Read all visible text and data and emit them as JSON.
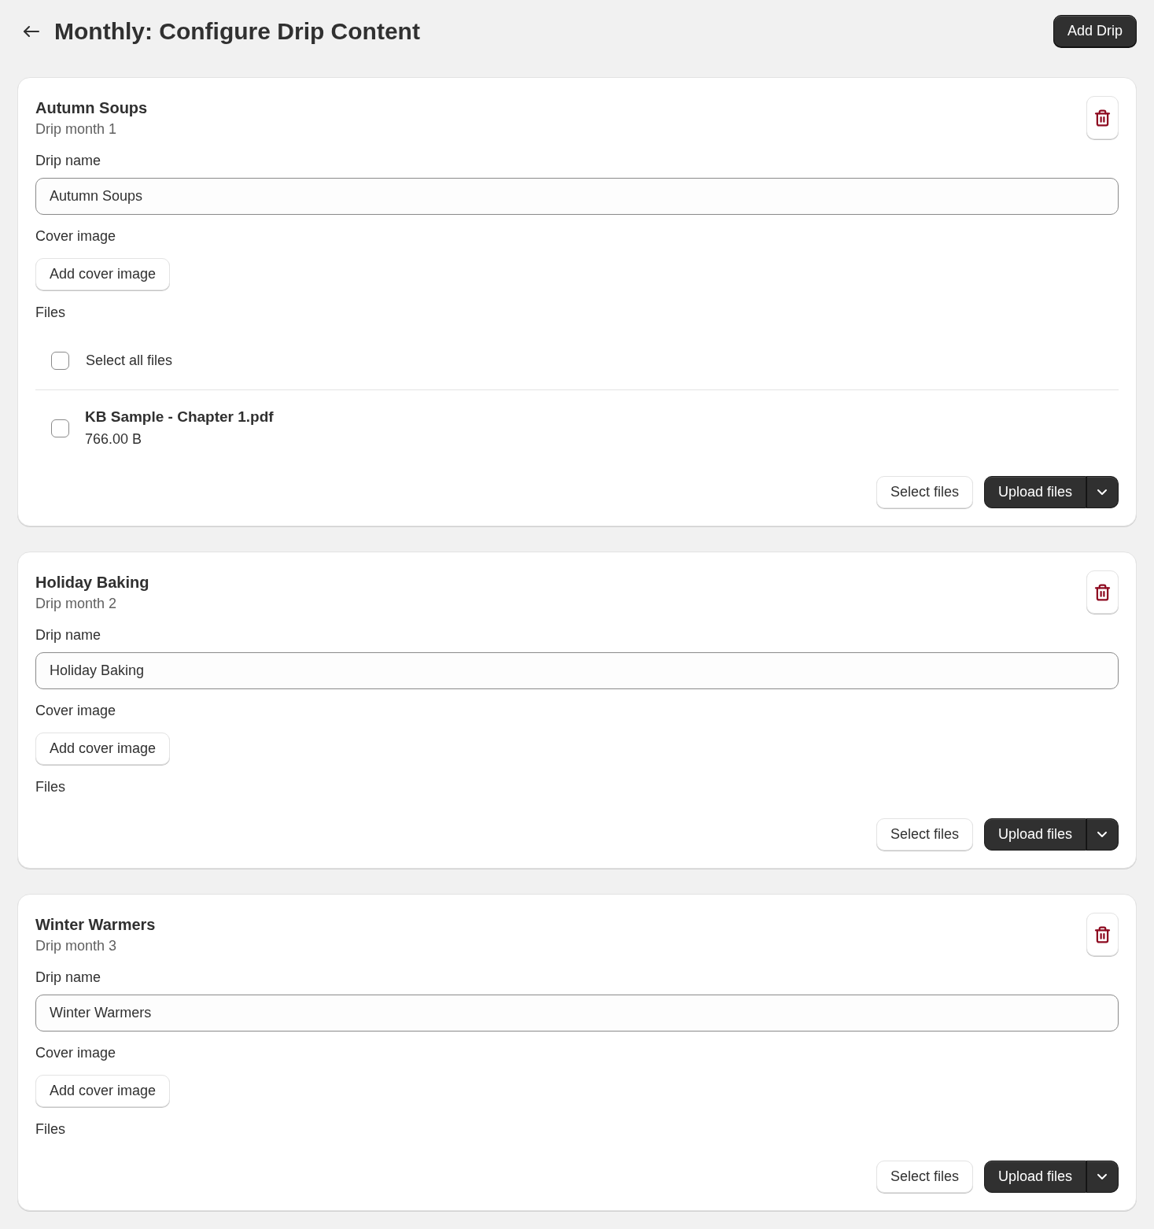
{
  "header": {
    "title": "Monthly: Configure Drip Content",
    "add_button": "Add Drip"
  },
  "drips": [
    {
      "title": "Autumn Soups",
      "subtitle": "Drip month 1",
      "name_label": "Drip name",
      "name_value": "Autumn Soups",
      "cover_label": "Cover image",
      "cover_button": "Add cover image",
      "files_label": "Files",
      "select_all": {
        "label": "Select all files",
        "checked": false
      },
      "files": [
        {
          "name": "KB Sample - Chapter 1.pdf",
          "size": "766.00 B",
          "checked": false
        }
      ],
      "select_button": "Select files",
      "upload_button": "Upload files"
    },
    {
      "title": "Holiday Baking",
      "subtitle": "Drip month 2",
      "name_label": "Drip name",
      "name_value": "Holiday Baking",
      "cover_label": "Cover image",
      "cover_button": "Add cover image",
      "files_label": "Files",
      "select_button": "Select files",
      "upload_button": "Upload files"
    },
    {
      "title": "Winter Warmers",
      "subtitle": "Drip month 3",
      "name_label": "Drip name",
      "name_value": "Winter Warmers",
      "cover_label": "Cover image",
      "cover_button": "Add cover image",
      "files_label": "Files",
      "select_button": "Select files",
      "upload_button": "Upload files"
    }
  ]
}
